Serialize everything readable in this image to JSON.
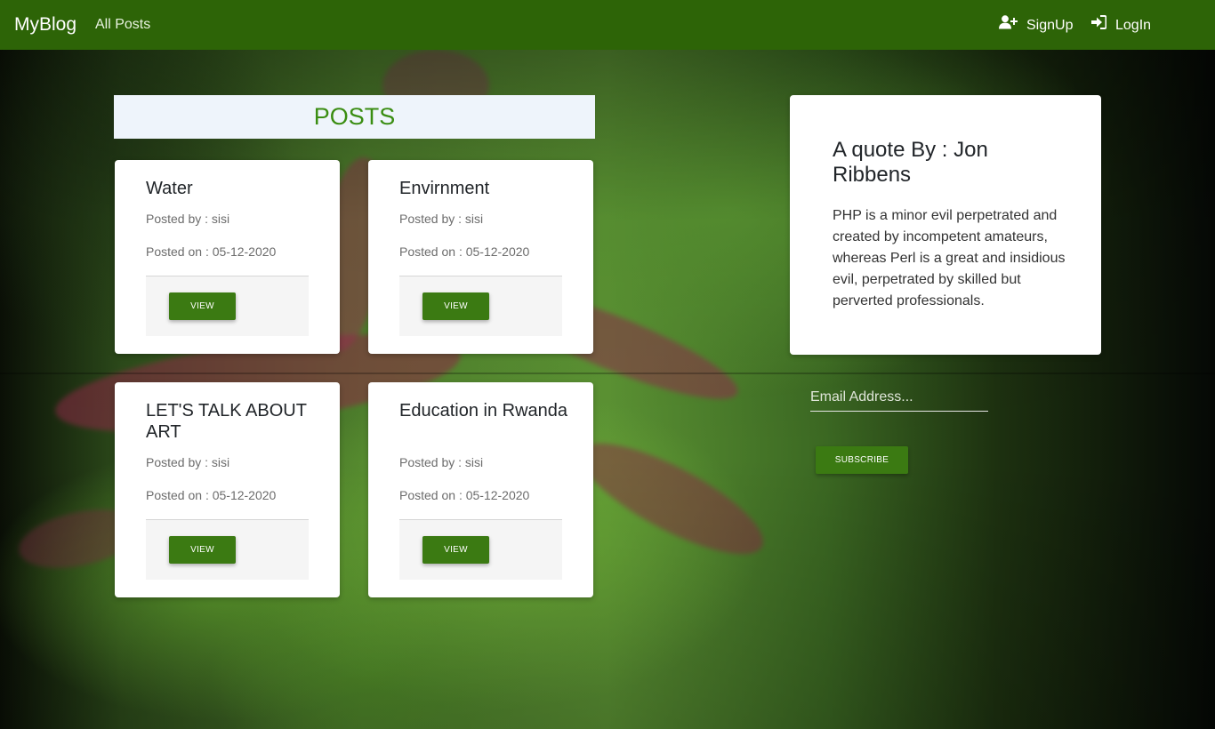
{
  "navbar": {
    "brand": "MyBlog",
    "all_posts": "All Posts",
    "signup": "SignUp",
    "login": "LogIn",
    "signup_icon": "user-plus-icon",
    "login_icon": "sign-in-icon"
  },
  "posts_header": "POSTS",
  "posts": [
    {
      "title": "Water",
      "posted_by": "Posted by : sisi",
      "posted_on": "Posted on : 05-12-2020",
      "button": "VIEW"
    },
    {
      "title": "Envirnment",
      "posted_by": "Posted by : sisi",
      "posted_on": "Posted on : 05-12-2020",
      "button": "VIEW"
    },
    {
      "title": "LET'S TALK ABOUT ART",
      "posted_by": "Posted by : sisi",
      "posted_on": "Posted on : 05-12-2020",
      "button": "VIEW"
    },
    {
      "title": "Education in Rwanda",
      "posted_by": "Posted by : sisi",
      "posted_on": "Posted on : 05-12-2020",
      "button": "VIEW"
    }
  ],
  "quote": {
    "title": "A quote By : Jon Ribbens",
    "text": "PHP is a minor evil perpetrated and created by incompetent amateurs, whereas Perl is a great and insidious evil, perpetrated by skilled but perverted professionals."
  },
  "subscribe": {
    "email_placeholder": "Email Address...",
    "email_value": "",
    "button": "SUBSCRIBE"
  },
  "colors": {
    "navbar": "#2d6407",
    "accent_button": "#3b7a12",
    "posts_header_text": "#3a8d12",
    "posts_header_bg": "#eef4fb"
  }
}
